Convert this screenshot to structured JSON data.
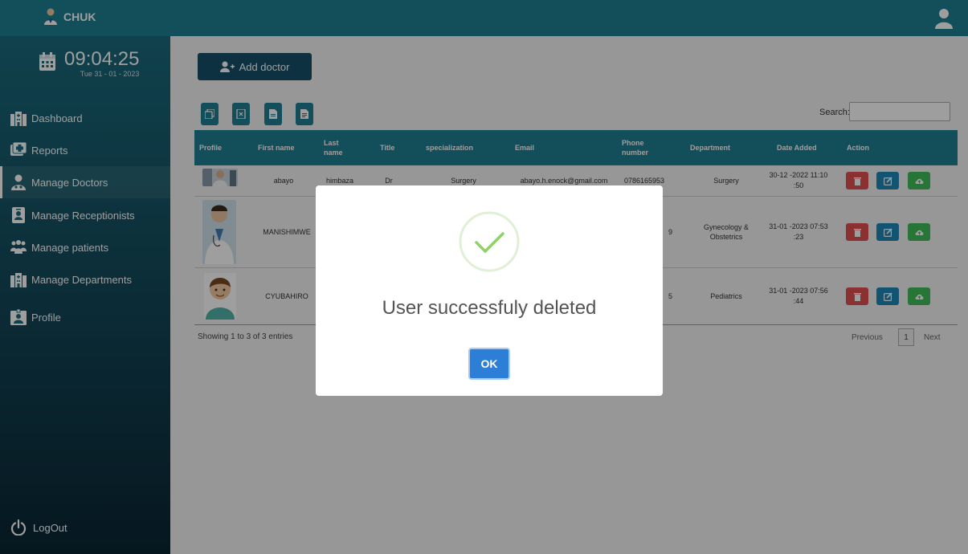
{
  "header": {
    "brand": "CHUK"
  },
  "clock": {
    "time": "09:04:25",
    "date": "Tue 31 - 01 - 2023"
  },
  "sidebar": {
    "items": [
      {
        "label": "Dashboard",
        "icon": "building-icon"
      },
      {
        "label": "Reports",
        "icon": "report-icon"
      },
      {
        "label": "Manage Doctors",
        "icon": "doctor-icon",
        "active": true
      },
      {
        "label": "Manage Receptionists",
        "icon": "id-badge-icon"
      },
      {
        "label": "Manage patients",
        "icon": "people-icon"
      },
      {
        "label": "Manage Departments",
        "icon": "building-icon"
      },
      {
        "label": "Profile",
        "icon": "profile-card-icon"
      }
    ],
    "logout": "LogOut"
  },
  "toolbar": {
    "add_doctor": "Add doctor",
    "search_label": "Search:",
    "search_value": ""
  },
  "table": {
    "columns": [
      "Profile",
      "First name",
      "Last name",
      "Title",
      "specialization",
      "Email",
      "Phone number",
      "Department",
      "Date Added",
      "Action"
    ],
    "rows": [
      {
        "first": "abayo",
        "last": "himbaza",
        "title": "Dr",
        "spec": "Surgery",
        "email": "abayo.h.enock@gmail.com",
        "phone": "0786165953",
        "dept": "Surgery",
        "date": "30-12 -2022 11:10 :50"
      },
      {
        "first": "MANISHIMWE",
        "last": "",
        "title": "",
        "spec": "",
        "email": "",
        "phone": "9",
        "dept": "Gynecology & Obstetrics",
        "date": "31-01 -2023 07:53 :23"
      },
      {
        "first": "CYUBAHIRO",
        "last": "",
        "title": "",
        "spec": "",
        "email": "",
        "phone": "5",
        "dept": "Pediatrics",
        "date": "31-01 -2023 07:56 :44"
      }
    ],
    "showing": "Showing 1 to 3 of 3 entries",
    "pager": {
      "previous": "Previous",
      "page": "1",
      "next": "Next"
    }
  },
  "modal": {
    "message": "User successfuly deleted",
    "ok": "OK"
  },
  "colors": {
    "teal": "#1f7f93",
    "delete": "#e35050",
    "edit": "#1e88b8",
    "upload": "#3fbf5a",
    "ok": "#2c7ed6"
  }
}
